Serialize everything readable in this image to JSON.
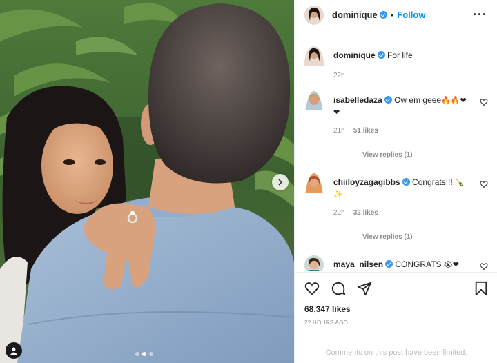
{
  "post": {
    "username": "dominique",
    "separator": "•",
    "follow_label": "Follow",
    "more_label": "···",
    "carousel": {
      "total_slides": 3,
      "active_slide": 2
    }
  },
  "caption": {
    "username": "dominique",
    "text": "For life",
    "time": "22h"
  },
  "comments": [
    {
      "username": "isabelledaza",
      "text": "Ow em geee",
      "emojis": "🔥🔥❤",
      "emojis_line2": "❤",
      "time": "21h",
      "likes": "51 likes",
      "replies": "View replies (1)"
    },
    {
      "username": "chiiloyzagagibbs",
      "text": "Congrats!!!",
      "emojis": "🍾",
      "emojis_line2": "✨",
      "time": "22h",
      "likes": "32 likes",
      "replies": "View replies (1)"
    },
    {
      "username": "maya_nilsen",
      "text": "CONGRATS",
      "emojis": "😭❤",
      "time": "",
      "likes": ""
    }
  ],
  "actions": {
    "like_icon": "heart-icon",
    "comment_icon": "comment-icon",
    "share_icon": "share-icon",
    "save_icon": "bookmark-icon"
  },
  "likes_count": "68,347 likes",
  "posted_time": "22 HOURS AGO",
  "comments_limited": "Comments on this post have been limited.",
  "colors": {
    "accent": "#0095f6",
    "verified": "#3897f0",
    "muted": "#8e8e8e"
  }
}
